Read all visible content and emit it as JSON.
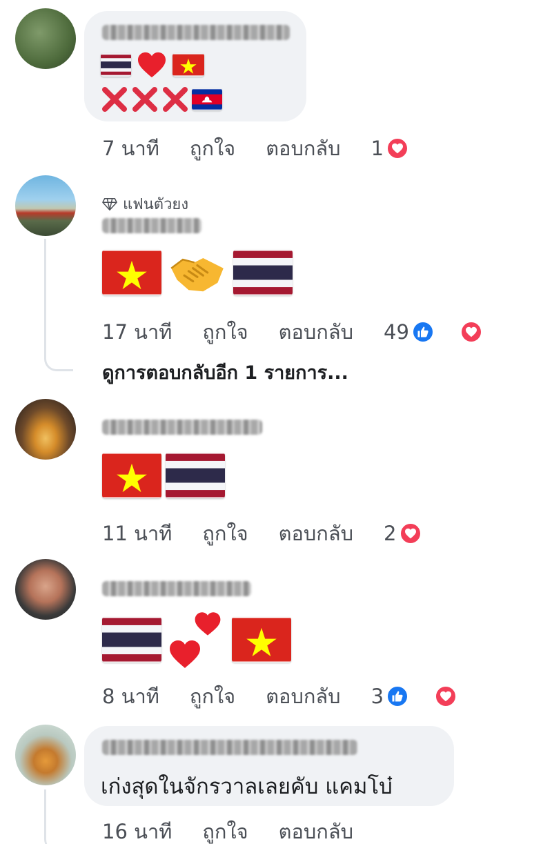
{
  "comments": [
    {
      "emoji_lines": [
        [
          "flag-thailand",
          "heart",
          "flag-vietnam"
        ],
        [
          "cross-mark",
          "cross-mark",
          "cross-mark",
          "flag-cambodia"
        ]
      ],
      "time": "7 นาที",
      "like_label": "ถูกใจ",
      "reply_label": "ตอบกลับ",
      "reaction_count": "1",
      "reactions": [
        "heart"
      ]
    },
    {
      "badge": "แฟนตัวยง",
      "emoji_lines": [
        [
          "flag-vietnam",
          "handshake",
          "flag-thailand"
        ]
      ],
      "time": "17 นาที",
      "like_label": "ถูกใจ",
      "reply_label": "ตอบกลับ",
      "reaction_count": "49",
      "reactions": [
        "like",
        "heart"
      ],
      "view_more": "ดูการตอบกลับอีก 1 รายการ..."
    },
    {
      "emoji_lines": [
        [
          "flag-vietnam",
          "flag-thailand"
        ]
      ],
      "time": "11 นาที",
      "like_label": "ถูกใจ",
      "reply_label": "ตอบกลับ",
      "reaction_count": "2",
      "reactions": [
        "heart"
      ]
    },
    {
      "emoji_lines": [
        [
          "flag-thailand",
          "two-hearts",
          "flag-vietnam"
        ]
      ],
      "time": "8 นาที",
      "like_label": "ถูกใจ",
      "reply_label": "ตอบกลับ",
      "reaction_count": "3",
      "reactions": [
        "like",
        "heart"
      ]
    },
    {
      "text": "เก่งสุดในจักรวาลเลยคับ แคมโบ๋",
      "time": "16 นาที",
      "like_label": "ถูกใจ",
      "reply_label": "ตอบกลับ"
    }
  ],
  "colors": {
    "bubble": "#f0f2f5",
    "meta_text": "#4b4f56",
    "heart": "#f33e58",
    "like": "#1877f2"
  }
}
